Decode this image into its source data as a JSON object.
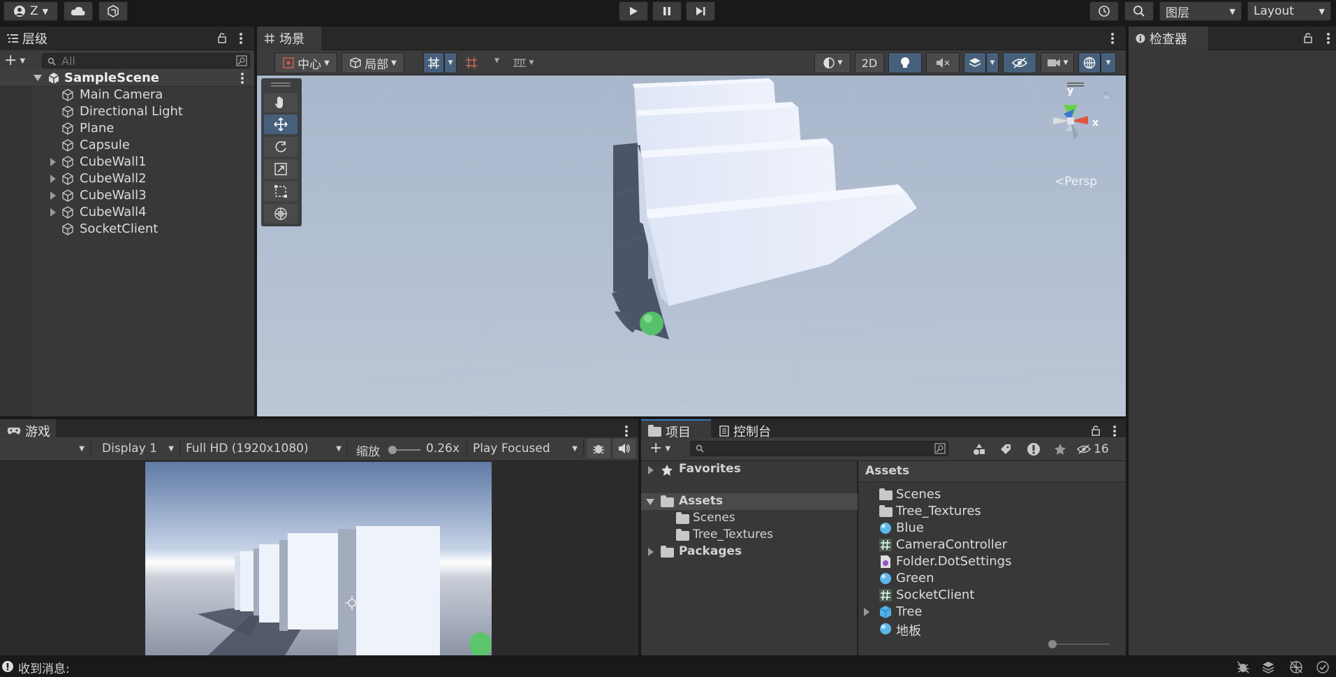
{
  "topbar": {
    "account_label": "Z",
    "search_icon": "search-icon",
    "layers_label": "图层",
    "layout_label": "Layout"
  },
  "hierarchy": {
    "tab_label": "层级",
    "search_placeholder": "All",
    "scene_name": "SampleScene",
    "items": [
      {
        "label": "Main Camera",
        "expandable": false
      },
      {
        "label": "Directional Light",
        "expandable": false
      },
      {
        "label": "Plane",
        "expandable": false
      },
      {
        "label": "Capsule",
        "expandable": false
      },
      {
        "label": "CubeWall1",
        "expandable": true
      },
      {
        "label": "CubeWall2",
        "expandable": true
      },
      {
        "label": "CubeWall3",
        "expandable": true
      },
      {
        "label": "CubeWall4",
        "expandable": true
      },
      {
        "label": "SocketClient",
        "expandable": false
      }
    ]
  },
  "scene": {
    "tab_label": "场景",
    "pivot_label": "中心",
    "space_label": "局部",
    "mode_2d_label": "2D",
    "gizmo_persp_label": "<Persp",
    "gizmo_y": "y",
    "gizmo_x": "x"
  },
  "inspector": {
    "tab_label": "检查器"
  },
  "game": {
    "tab_label": "游戏",
    "display_label": "Display 1",
    "resolution_label": "Full HD (1920x1080)",
    "scale_label": "缩放",
    "scale_value": "0.26x",
    "play_mode_label": "Play Focused"
  },
  "project": {
    "tab_project": "项目",
    "tab_console": "控制台",
    "hidden_count": "16",
    "tree": {
      "favorites": "Favorites",
      "assets": "Assets",
      "assets_children": [
        "Scenes",
        "Tree_Textures"
      ],
      "packages": "Packages"
    },
    "assets_header": "Assets",
    "assets": [
      {
        "label": "Scenes",
        "icon": "folder-icon"
      },
      {
        "label": "Tree_Textures",
        "icon": "folder-icon"
      },
      {
        "label": "Blue",
        "icon": "material-icon"
      },
      {
        "label": "CameraController",
        "icon": "script-icon"
      },
      {
        "label": "Folder.DotSettings",
        "icon": "settings-file-icon"
      },
      {
        "label": "Green",
        "icon": "material-icon"
      },
      {
        "label": "SocketClient",
        "icon": "script-icon"
      },
      {
        "label": "Tree",
        "icon": "prefab-icon"
      },
      {
        "label": "地板",
        "icon": "material-icon"
      }
    ]
  },
  "statusbar": {
    "message": "收到消息:"
  },
  "colors": {
    "accent": "#2c5d87",
    "panel_bg": "#383838",
    "header_bg": "#282828"
  }
}
